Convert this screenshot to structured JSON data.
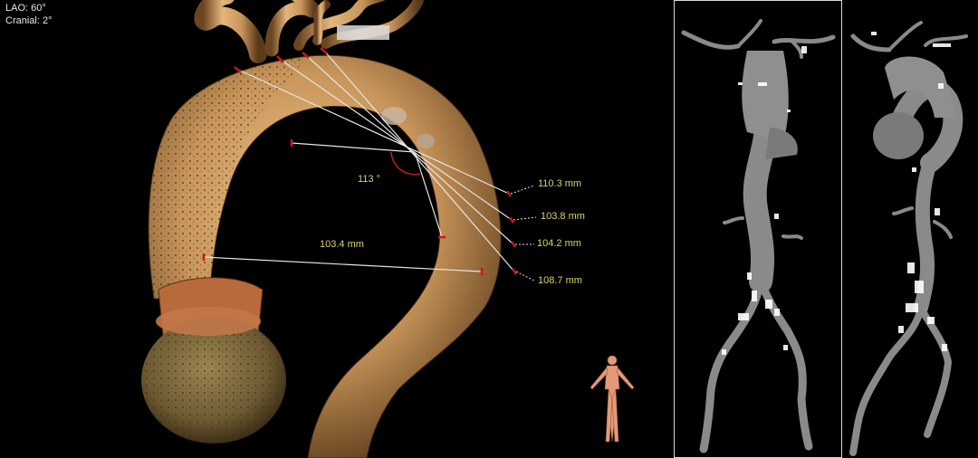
{
  "viewport": {
    "orientation": {
      "lao": "LAO: 60°",
      "cranial": "Cranial: 2°"
    },
    "measurements": {
      "angle": "113 °",
      "distance_main": "103.4 mm",
      "distance_1": "110.3 mm",
      "distance_2": "103.8 mm",
      "distance_3": "104.2 mm",
      "distance_4": "108.7 mm"
    },
    "colors": {
      "vessel": "#c8955a",
      "annotation_text": "#d8d46a",
      "angle_arc": "#c8181c",
      "measure_line": "#e6e6e6"
    },
    "icons": [
      "orientation-human-figure-icon"
    ]
  }
}
